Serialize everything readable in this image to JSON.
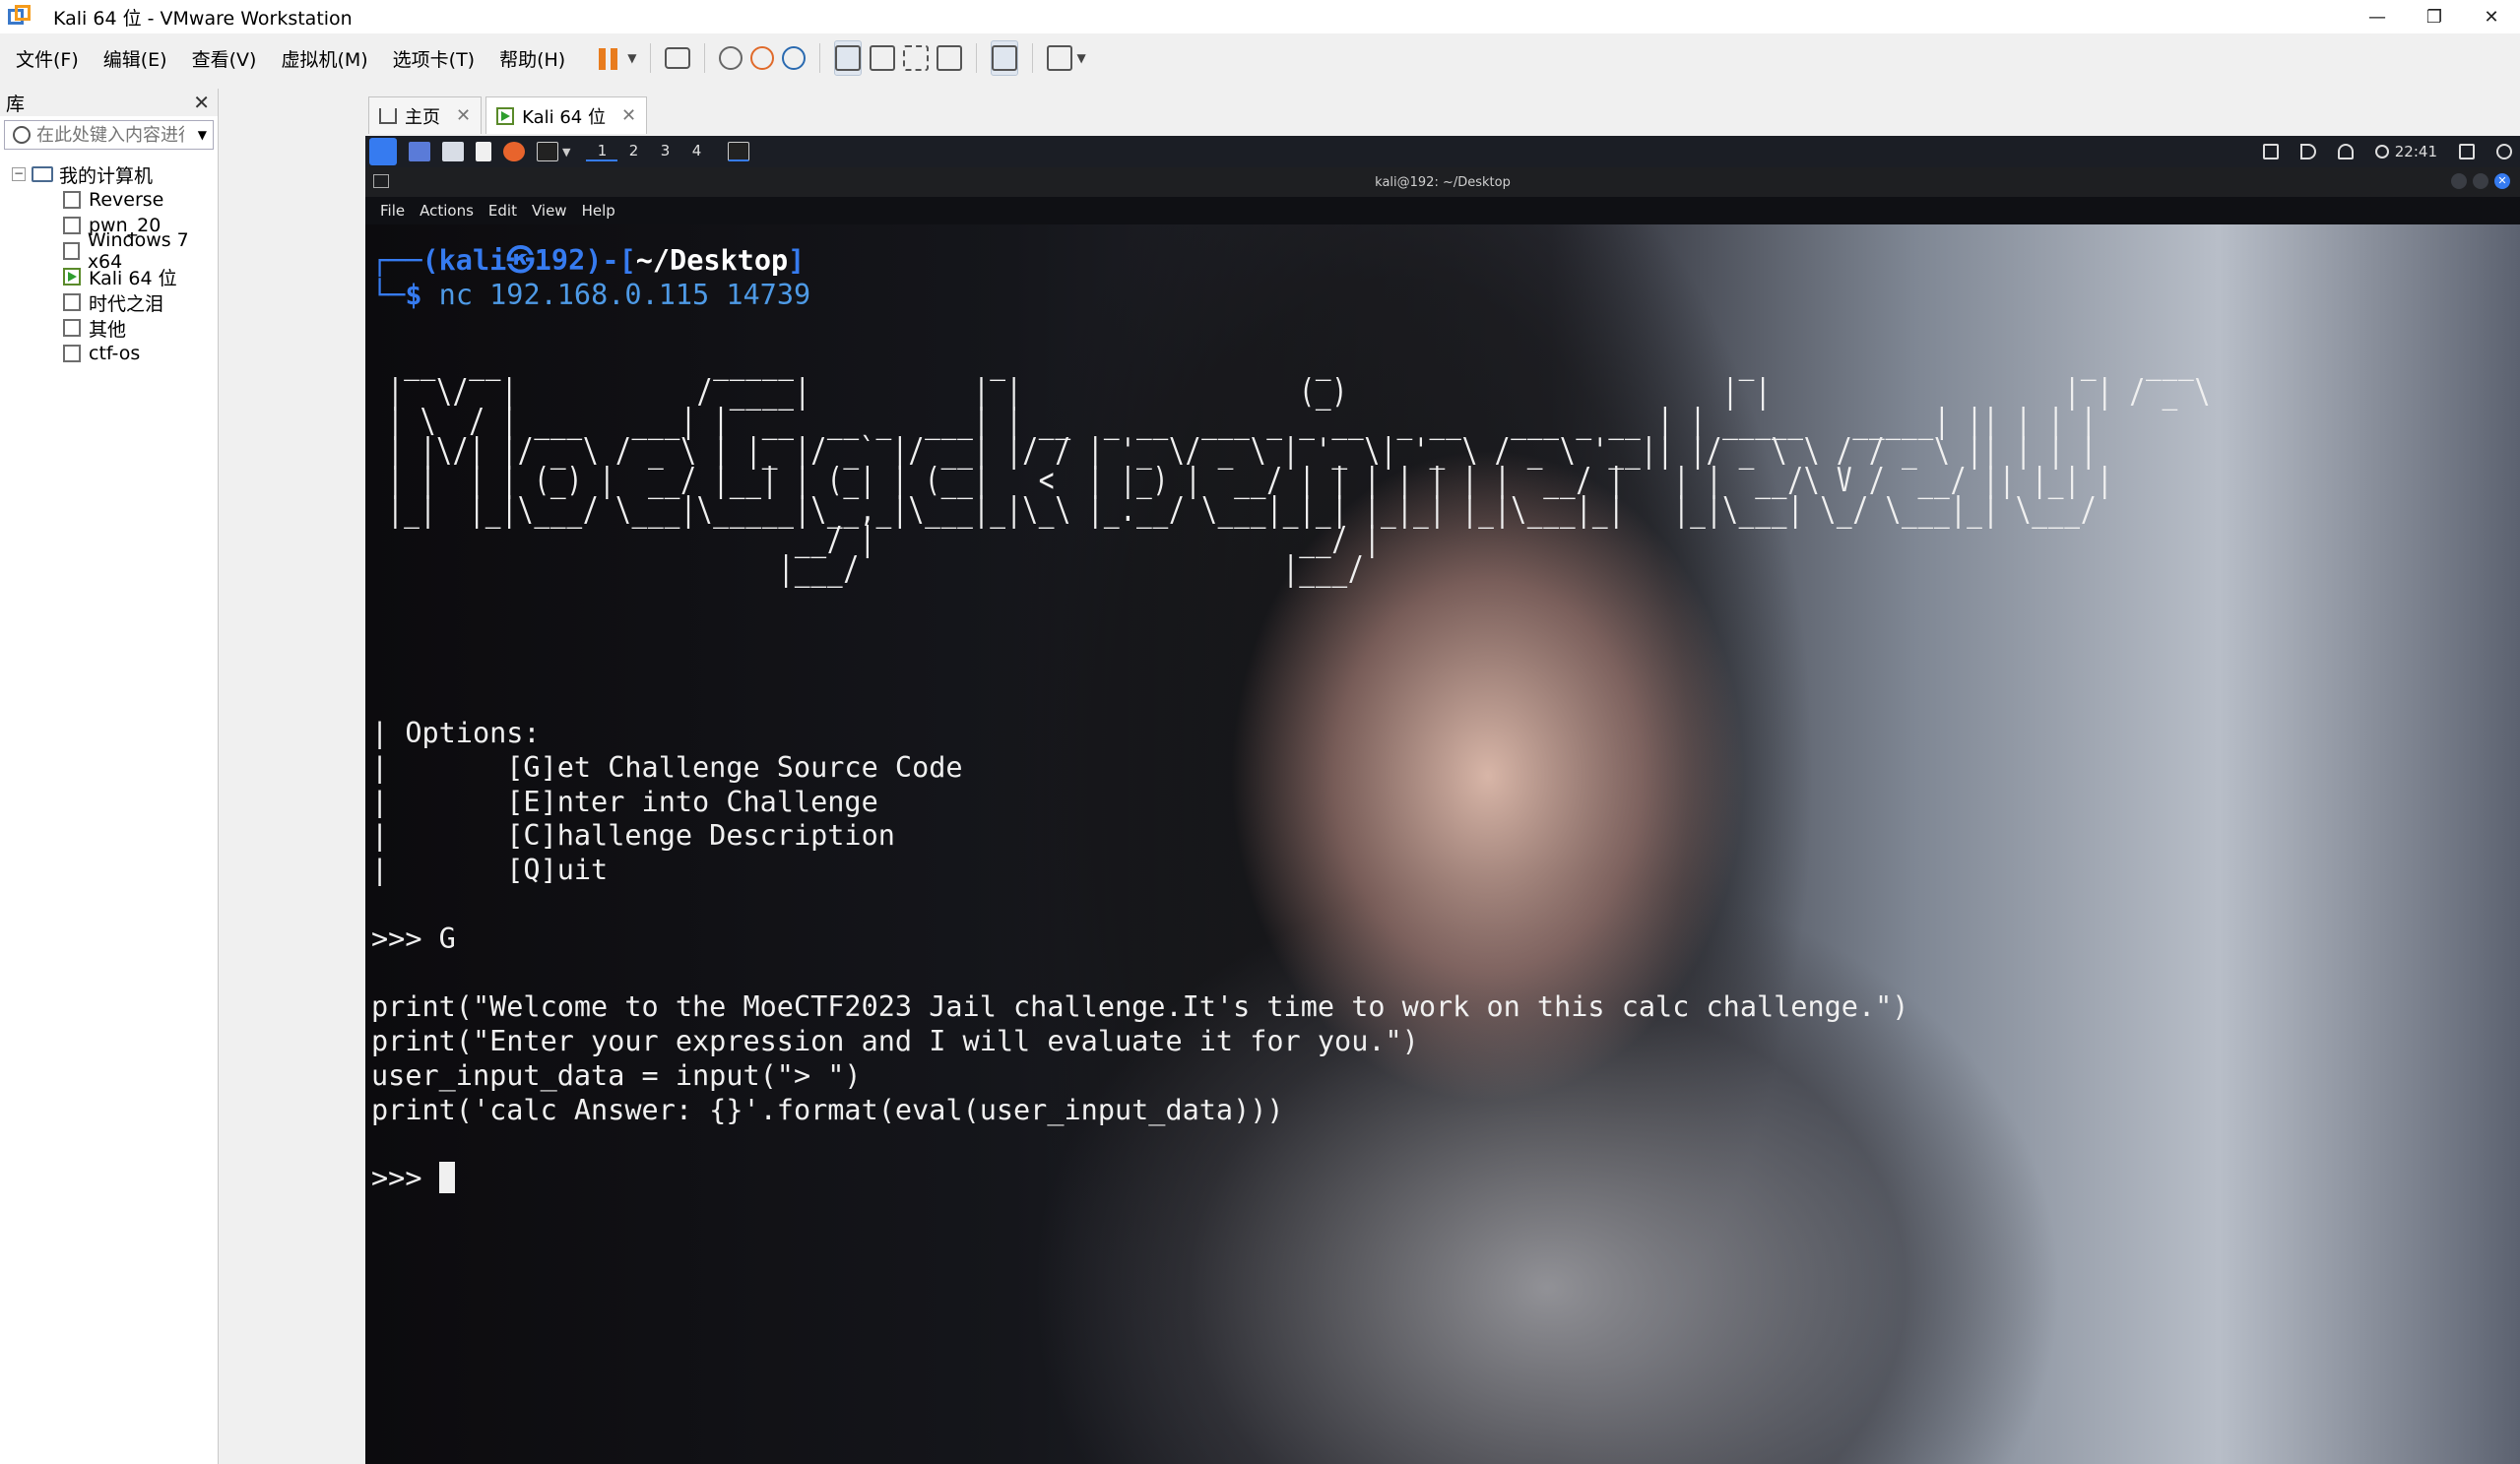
{
  "window": {
    "title": "Kali 64 位 - VMware Workstation",
    "logo_icon": "vmware-logo-icon",
    "controls": [
      "—",
      "❐",
      "✕"
    ]
  },
  "menu": {
    "file": "文件(F)",
    "edit": "编辑(E)",
    "view": "查看(V)",
    "vm": "虚拟机(M)",
    "tabs": "选项卡(T)",
    "help": "帮助(H)"
  },
  "toolbar": {
    "icons": [
      "pause-icon",
      "send-ctrl-alt-del-icon",
      "snapshot-icon",
      "revert-snapshot-icon",
      "snapshot-manager-icon",
      "show-library-icon",
      "thumbnail-bar-icon",
      "fullscreen-icon",
      "unity-icon",
      "console-view-icon",
      "stretch-icon"
    ],
    "accent": "#e87c1e"
  },
  "library": {
    "title": "库",
    "close": "✕",
    "search_placeholder": "在此处键入内容进行搜索",
    "root": "我的计算机",
    "expander": "−",
    "items": [
      {
        "label": "Reverse",
        "running": false
      },
      {
        "label": "pwn_20",
        "running": false
      },
      {
        "label": "Windows 7 x64",
        "running": false
      },
      {
        "label": "Kali 64 位",
        "running": true
      },
      {
        "label": "时代之泪",
        "running": false
      },
      {
        "label": "其他",
        "running": false
      },
      {
        "label": "ctf-os",
        "running": false
      }
    ]
  },
  "tabs": [
    {
      "label": "主页",
      "close": "✕",
      "active": false
    },
    {
      "label": "Kali 64 位",
      "close": "✕",
      "active": true
    }
  ],
  "guest": {
    "workspaces": [
      "1",
      "2",
      "3",
      "4"
    ],
    "clock": "22:41",
    "terminal_title": "kali@192: ~/Desktop",
    "terminal_menu": [
      "File",
      "Actions",
      "Edit",
      "View",
      "Help"
    ],
    "close_glyph": "✕",
    "prompt": {
      "corner_top": "┌──(",
      "user": "kali㉿192",
      "mid": ")-[",
      "path": "~/Desktop",
      "end": "]",
      "corner_bottom": "└─",
      "dollar": "$ ",
      "command": "nc 192.168.0.115 14739"
    },
    "ascii_banner": "  __  __             _____            _                   _                         _                    _   ___  \n |  \\/  |           / ____|          | |                 (_)                       | |                  | | / _ \\ \n | \\  / | ___   ___| |  __  __ _  ___| | __  _ __  ___ _ _ __  _ __   ___ _ __ | | _____   _____| || | | |\n | |\\/| |/ _ \\ / _ \\ | |_ |/ _` |/ __| |/ / | '_ \\/ _ \\ | '_ \\| '_ \\ / _ \\ '__|| |/ _ \\ \\ / / _ \\ || | | |\n | |  | | (_) |  __/ |__| | (_| | (__|   <  | |_) |  __/ | | | | | | |  __/ |   | |  __/\\ V /  __/ || |_| |\n |_|  |_|\\___/ \\___|\\_____|\\__,_|\\___|_|\\_\\ |_.__/ \\___|_|_| |_|_| |_|\\___|_|   |_|\\___| \\_/ \\___|_| \\___/ \n                          __/ |                          __/ |\n                         |___/                          |___/ ",
    "options": [
      "| Options:",
      "|       [G]et Challenge Source Code",
      "|       [E]nter into Challenge",
      "|       [C]hallenge Description",
      "|       [Q]uit"
    ],
    "input_line": ">>> G",
    "source": [
      "print(\"Welcome to the MoeCTF2023 Jail challenge.It's time to work on this calc challenge.\")",
      "print(\"Enter your expression and I will evaluate it for you.\")",
      "user_input_data = input(\"> \")",
      "print('calc Answer: {}'.format(eval(user_input_data)))"
    ],
    "final_prompt": ">>> "
  }
}
